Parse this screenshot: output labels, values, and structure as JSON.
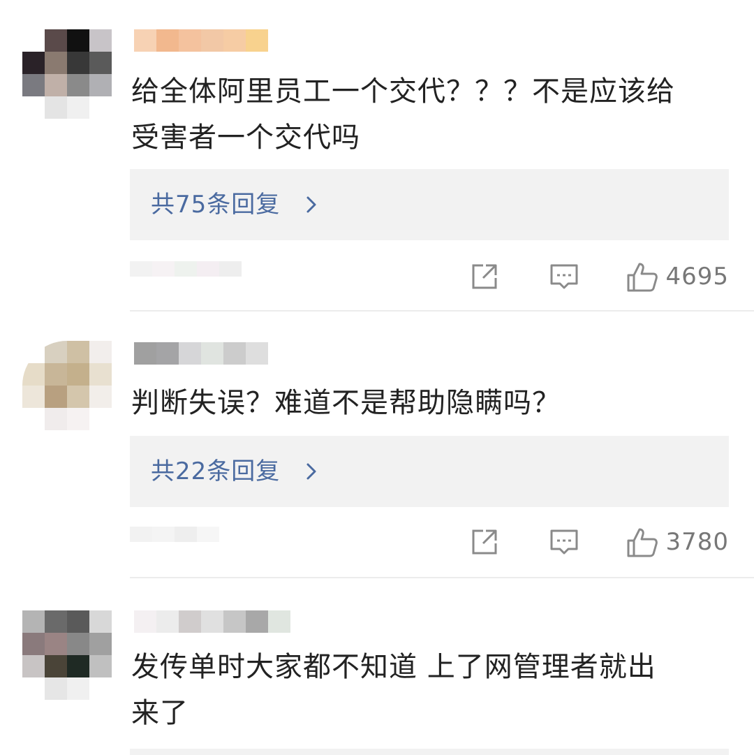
{
  "comments": [
    {
      "text_line1": "给全体阿里员工一个交代？？？不是应该给",
      "text_line2": "受害者一个交代吗",
      "reply_label": "共75条回复",
      "likes": "4695",
      "icons": [
        "share-icon",
        "comment-icon",
        "like-icon",
        "chevron-right-icon"
      ]
    },
    {
      "text_line1": "判断失误？难道不是帮助隐瞒吗？",
      "text_line2": "",
      "reply_label": "共22条回复",
      "likes": "3780",
      "icons": [
        "share-icon",
        "comment-icon",
        "like-icon",
        "chevron-right-icon"
      ]
    },
    {
      "text_line1": "发传单时大家都不知道 上了网管理者就出",
      "text_line2": "来了"
    }
  ],
  "colors": {
    "reply_link": "#4a6aa0",
    "reply_bg": "#f2f2f2",
    "meta_gray": "#777777",
    "icon_gray": "#8a8a8a",
    "divider": "#ececec"
  }
}
